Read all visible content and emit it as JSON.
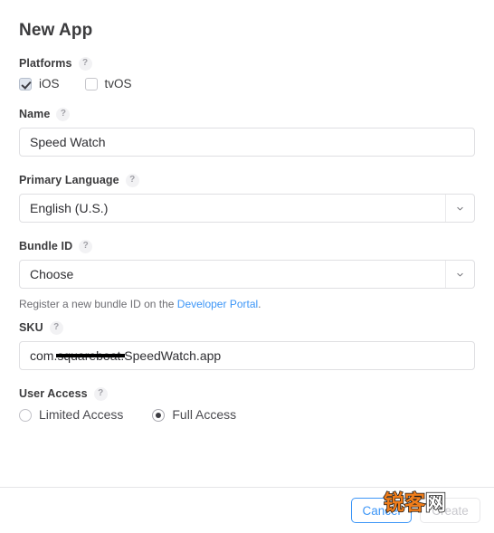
{
  "dialog": {
    "title": "New App",
    "help_glyph": "?"
  },
  "platforms": {
    "label": "Platforms",
    "options": [
      {
        "label": "iOS",
        "checked": true
      },
      {
        "label": "tvOS",
        "checked": false
      }
    ]
  },
  "name": {
    "label": "Name",
    "value": "Speed Watch",
    "placeholder": ""
  },
  "primary_language": {
    "label": "Primary Language",
    "value": "English (U.S.)"
  },
  "bundle_id": {
    "label": "Bundle ID",
    "value": "Choose",
    "hint_prefix": "Register a new bundle ID on the ",
    "hint_link": "Developer Portal",
    "hint_suffix": "."
  },
  "sku": {
    "label": "SKU",
    "value_prefix": "com.",
    "value_redacted": "squareboat.",
    "value_suffix": "SpeedWatch.app"
  },
  "user_access": {
    "label": "User Access",
    "options": [
      {
        "label": "Limited Access",
        "selected": false
      },
      {
        "label": "Full Access",
        "selected": true
      }
    ]
  },
  "footer": {
    "cancel_label": "Cancel",
    "create_label": "Create"
  },
  "watermark": {
    "part_one": "锐客",
    "part_two": "网"
  },
  "colors": {
    "accent_blue": "#3d96f7",
    "text_primary": "#3b3b3d",
    "border": "#dfdfe2",
    "checkbox_fill": "#dfe5ee"
  }
}
